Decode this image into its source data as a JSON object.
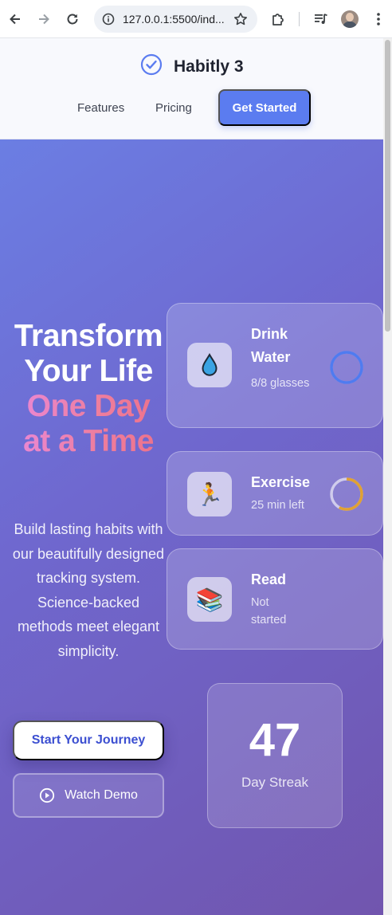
{
  "browser": {
    "url": "127.0.0.1:5500/ind...",
    "icons": [
      "back-arrow-icon",
      "forward-arrow-icon",
      "reload-icon",
      "site-info-icon",
      "bookmark-star-icon",
      "extensions-puzzle-icon",
      "media-controls-icon",
      "profile-avatar",
      "more-menu-icon"
    ]
  },
  "header": {
    "brand": "Habitly 3",
    "nav": [
      "Features",
      "Pricing"
    ],
    "cta": "Get Started",
    "accent_color": "#5b7cf0"
  },
  "hero": {
    "title_white": [
      "Transform",
      "Your Life"
    ],
    "title_gradient": [
      "One Day",
      "at a Time"
    ],
    "subtitle": "Build lasting habits with our beautifully designed tracking system. Science-backed methods meet elegant simplicity.",
    "primary_button": "Start Your Journey",
    "secondary_button": "Watch Demo"
  },
  "habits": [
    {
      "icon": "water-drop-icon",
      "emoji": "💧",
      "title": "Drink Water",
      "status": "8/8 glasses",
      "progress": 1.0,
      "ring_color": "#4f7bf0"
    },
    {
      "icon": "running-person-icon",
      "emoji": "🏃",
      "title": "Exercise",
      "status": "25 min left",
      "progress": 0.58,
      "ring_color": "#e0a133"
    },
    {
      "icon": "books-icon",
      "emoji": "📚",
      "title": "Read",
      "status": "Not started",
      "progress": 0
    }
  ],
  "streak": {
    "value": "47",
    "label": "Day Streak"
  }
}
